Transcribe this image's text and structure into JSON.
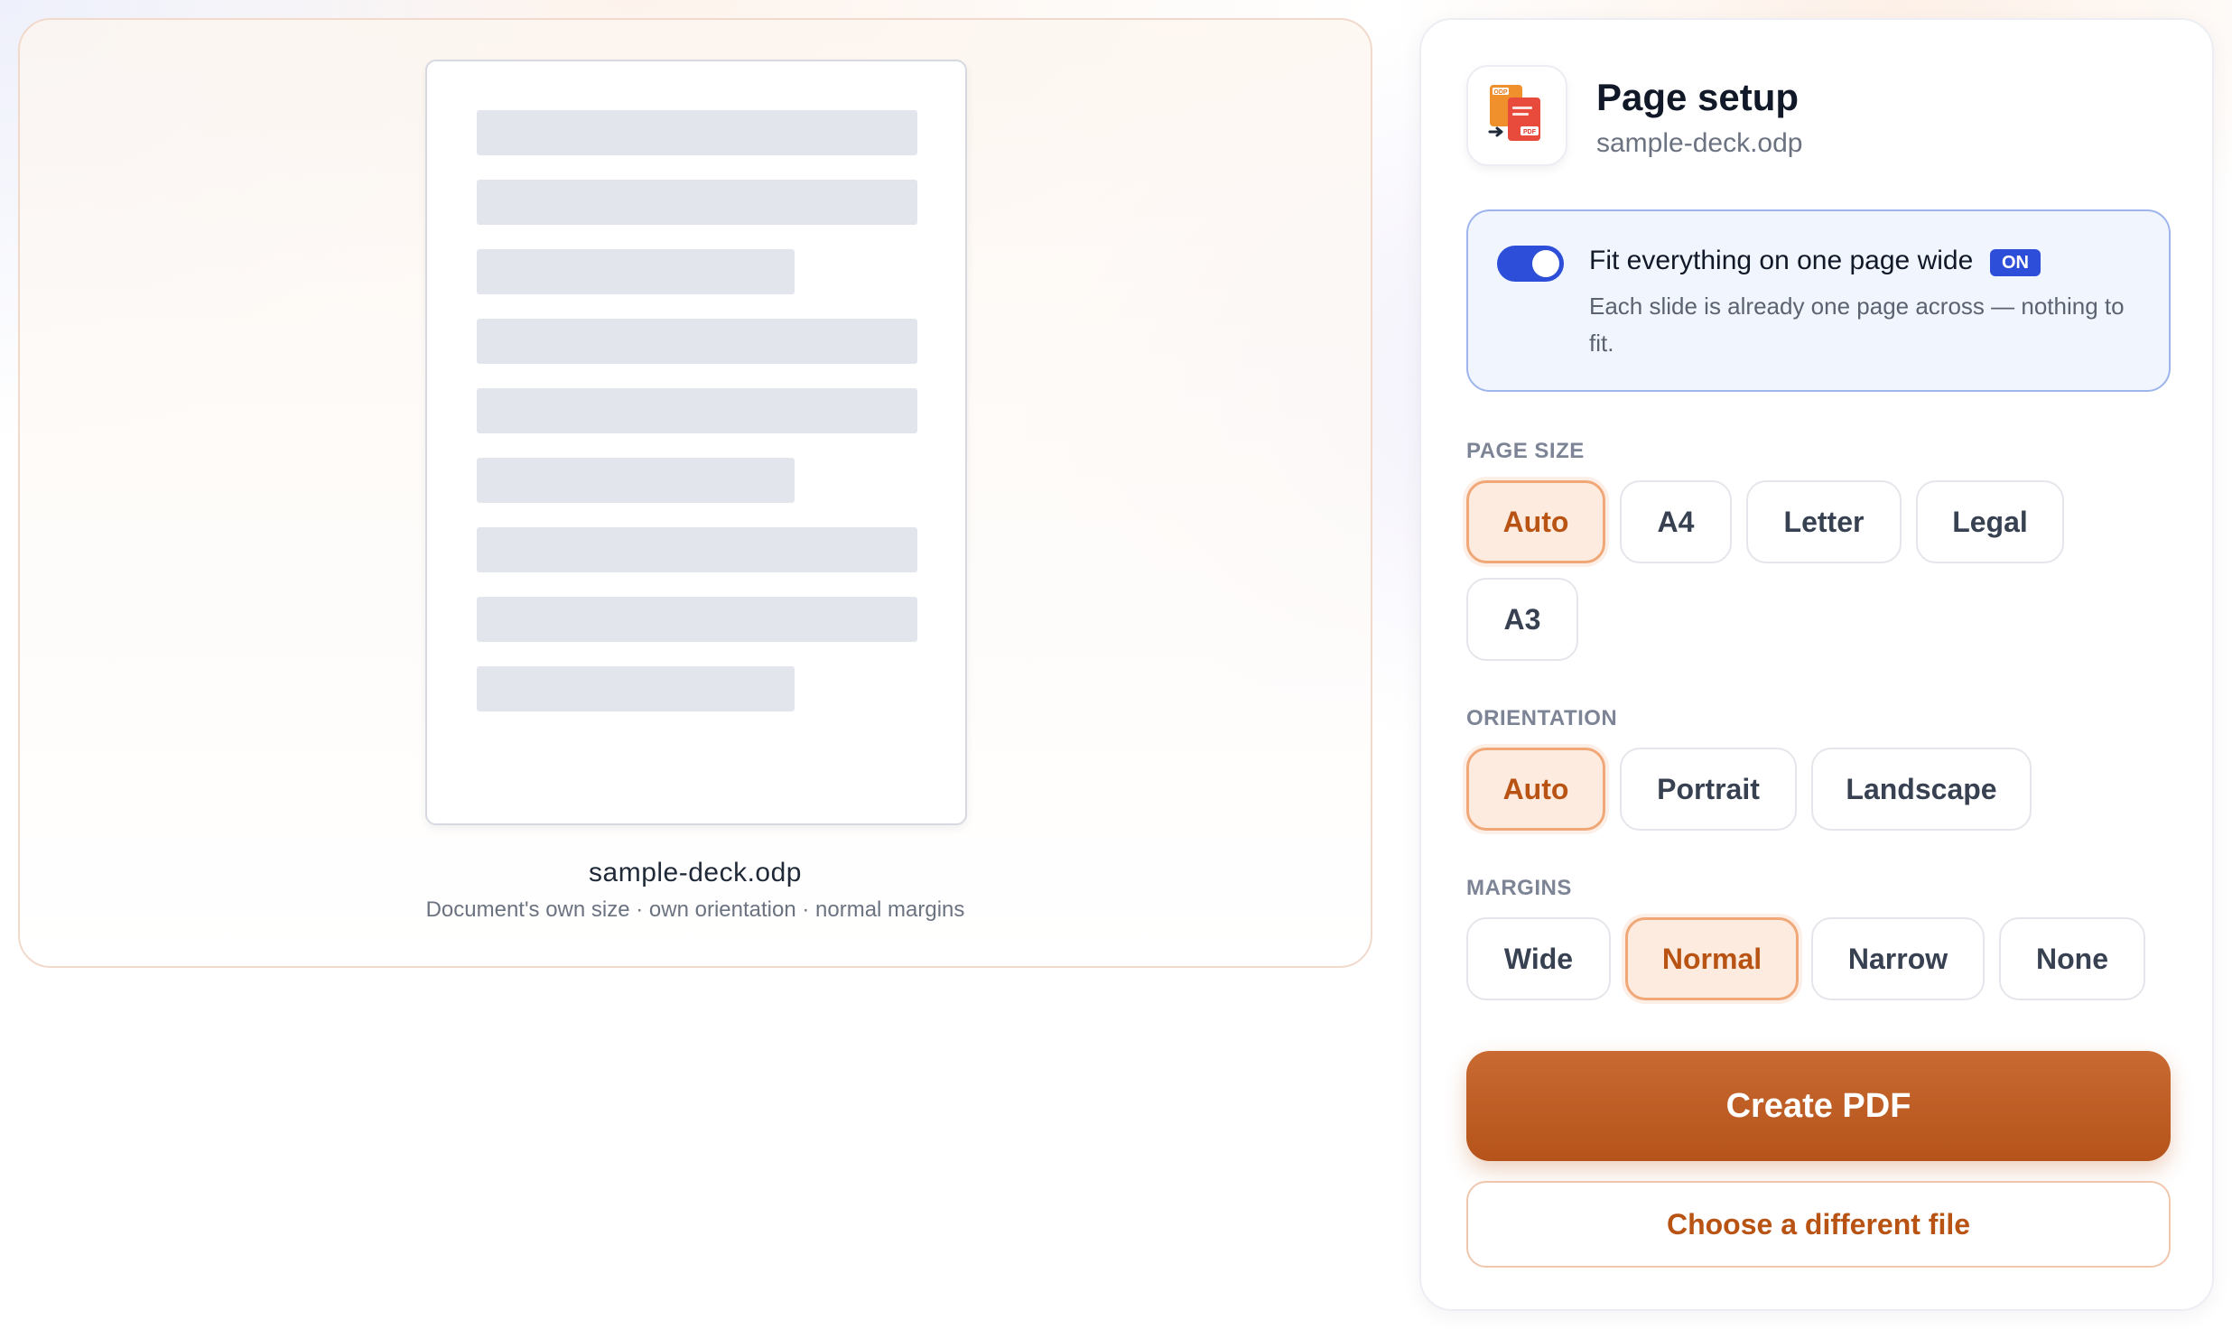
{
  "preview": {
    "file_name": "sample-deck.odp",
    "meta": "Document's own size · own orientation · normal margins"
  },
  "panel": {
    "icon": "odp-to-pdf-icon",
    "icon_labels": {
      "top": "ODP",
      "bottom": "PDF"
    },
    "title": "Page setup",
    "subtitle": "sample-deck.odp",
    "fit": {
      "label": "Fit everything on one page wide",
      "enabled": true,
      "badge": "ON",
      "description": "Each slide is already one page across — nothing to fit."
    },
    "page_size": {
      "label": "PAGE SIZE",
      "options": [
        "Auto",
        "A4",
        "Letter",
        "Legal",
        "A3"
      ],
      "selected": "Auto"
    },
    "orientation": {
      "label": "ORIENTATION",
      "options": [
        "Auto",
        "Portrait",
        "Landscape"
      ],
      "selected": "Auto"
    },
    "margins": {
      "label": "MARGINS",
      "options": [
        "Wide",
        "Normal",
        "Narrow",
        "None"
      ],
      "selected": "Normal"
    },
    "create_label": "Create PDF",
    "choose_label": "Choose a different file"
  },
  "colors": {
    "accent": "#b85313",
    "accent_bg": "#fdebdf",
    "toggle_blue": "#2c4ed8"
  }
}
